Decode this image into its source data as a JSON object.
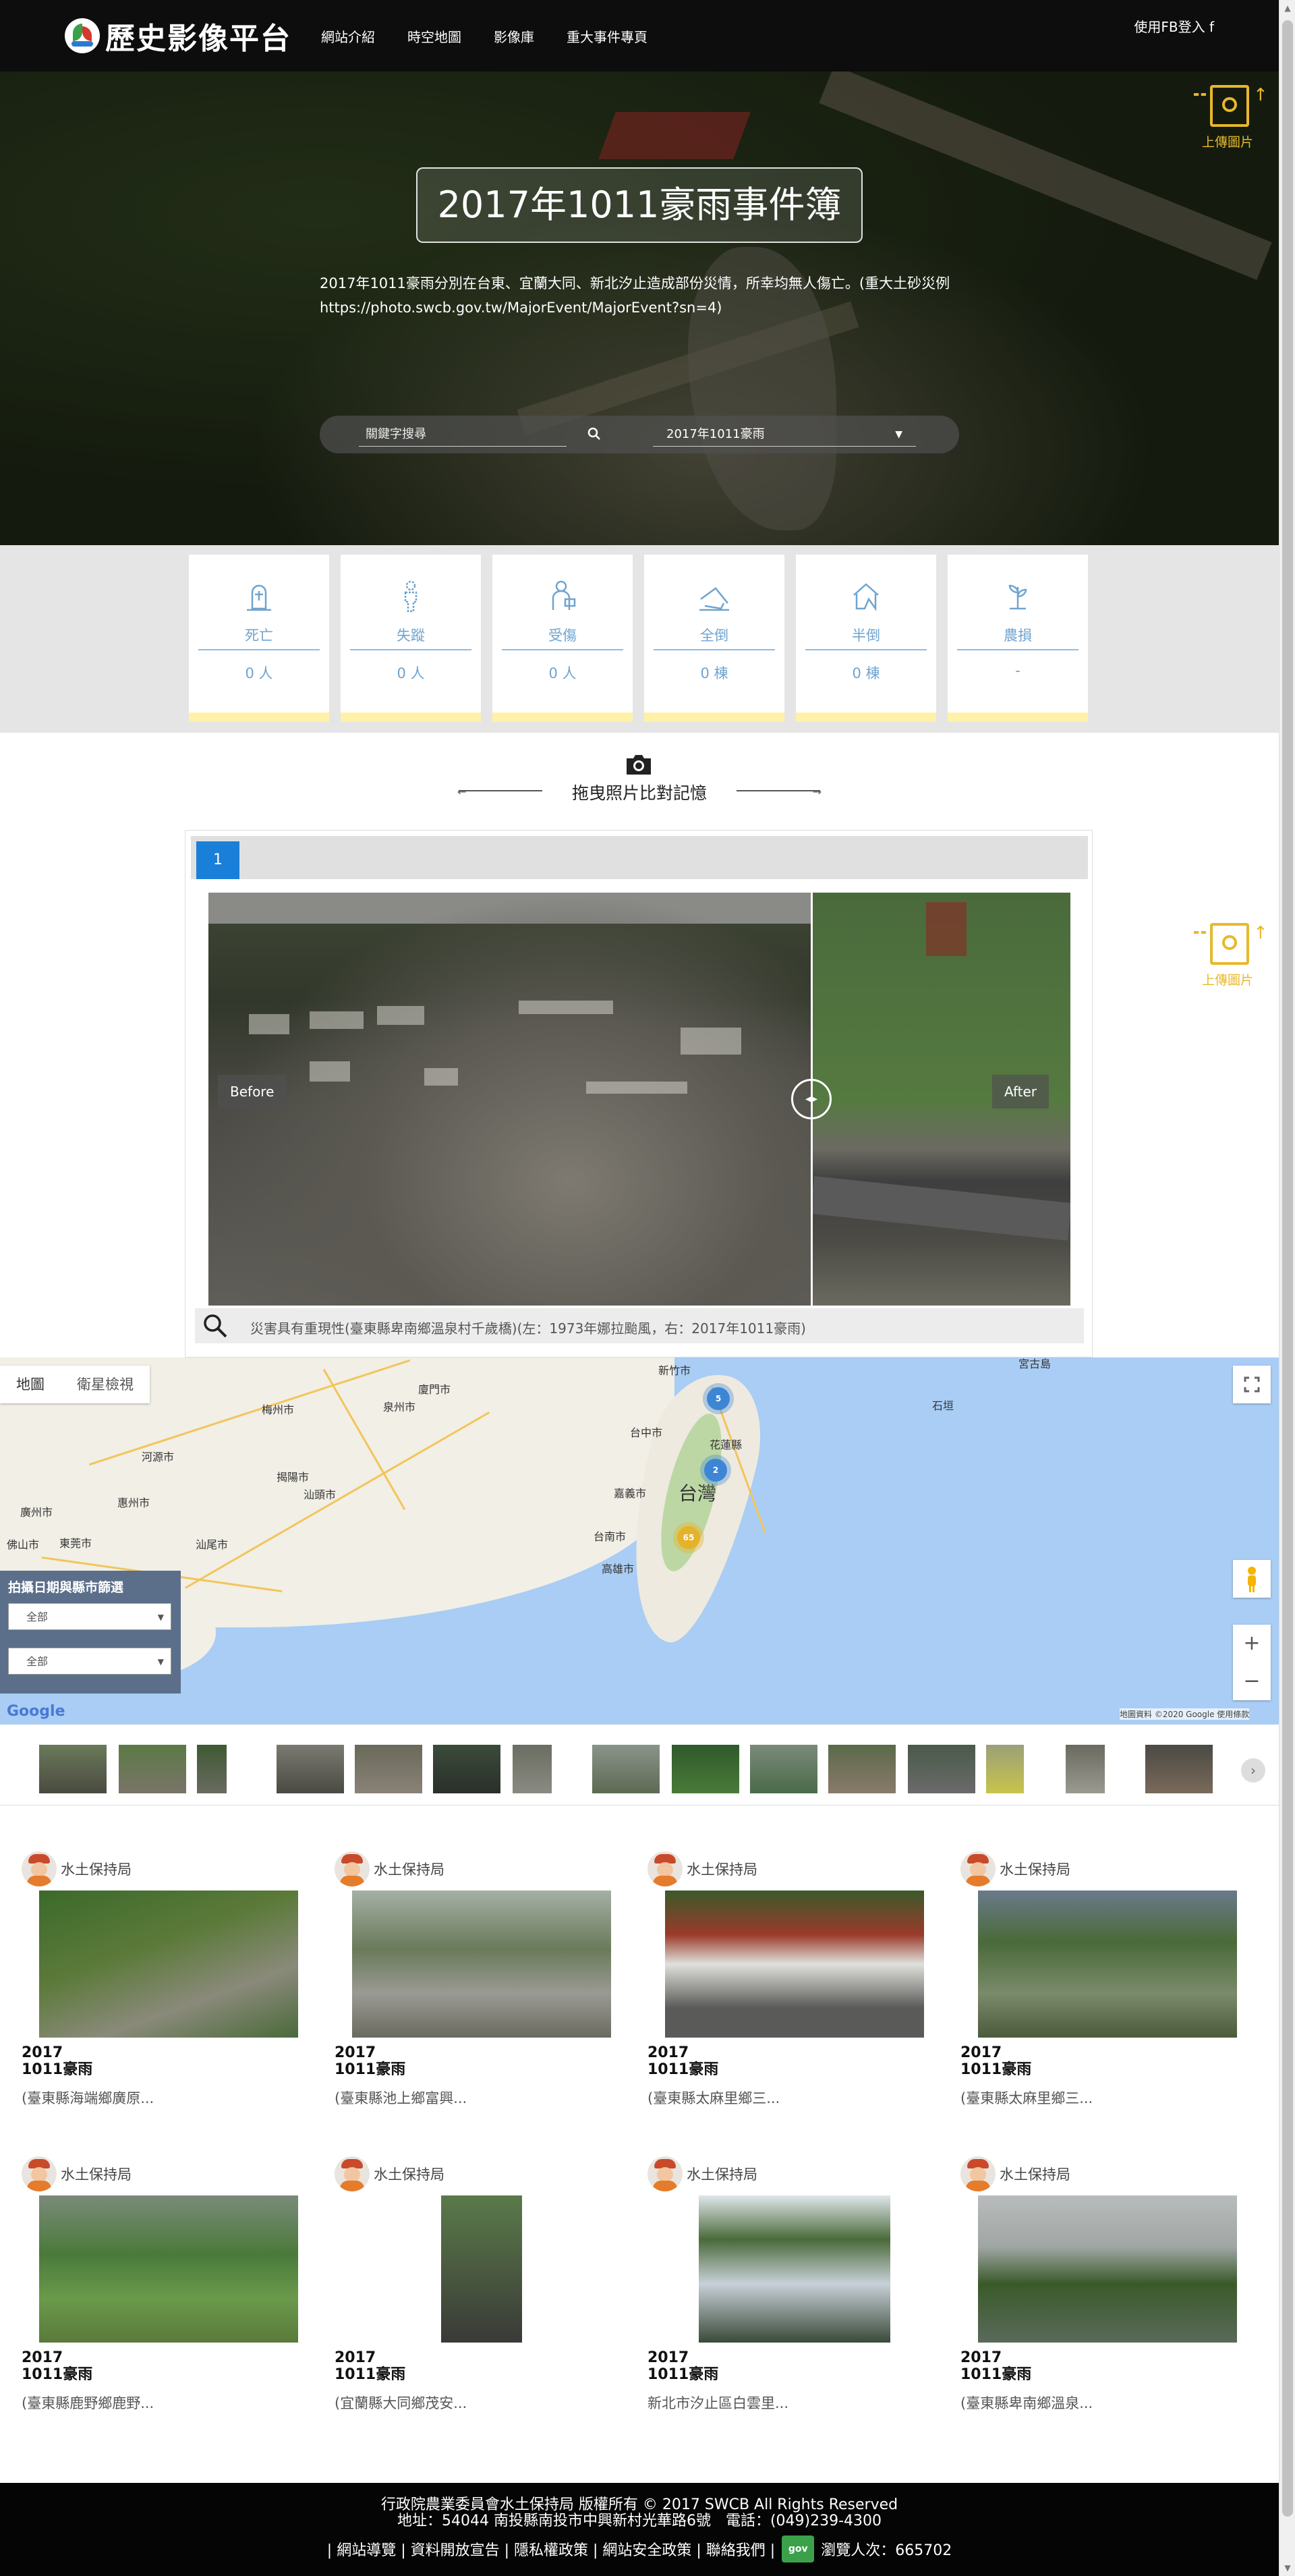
{
  "nav": {
    "logo_text": "歷史影像平台",
    "menu": [
      "網站介紹",
      "時空地圖",
      "影像庫",
      "重大事件專頁"
    ],
    "fb_login": "使用FB登入 f"
  },
  "hero": {
    "title": "2017年1011豪雨事件簿",
    "description": "2017年1011豪雨分別在台東、宜蘭大同、新北汐止造成部份災情，所幸均無人傷亡。(重大土砂災例 https://photo.swcb.gov.tw/MajorEvent/MajorEvent?sn=4)",
    "search_placeholder": "關鍵字搜尋",
    "event_select": "2017年1011豪雨",
    "upload_label": "上傳圖片"
  },
  "stats": [
    {
      "icon": "death-icon",
      "label": "死亡",
      "value": "0 人"
    },
    {
      "icon": "missing-icon",
      "label": "失蹤",
      "value": "0 人"
    },
    {
      "icon": "injured-icon",
      "label": "受傷",
      "value": "0 人"
    },
    {
      "icon": "collapsed-house-icon",
      "label": "全倒",
      "value": "0 棟"
    },
    {
      "icon": "half-collapsed-house-icon",
      "label": "半倒",
      "value": "0 棟"
    },
    {
      "icon": "agriculture-loss-icon",
      "label": "農損",
      "value": "-"
    }
  ],
  "compare": {
    "title": "拖曳照片比對記憶",
    "tab": "1",
    "before_label": "Before",
    "after_label": "After",
    "caption": "災害具有重現性(臺東縣卑南鄉溫泉村千歲橋)(左：1973年娜拉颱風，右：2017年1011豪雨)"
  },
  "map": {
    "type_map": "地圖",
    "type_satellite": "衛星檢視",
    "filter_title": "拍攝日期與縣市篩選",
    "filter_date": "全部",
    "filter_county": "全部",
    "country_label": "台灣",
    "clusters": [
      "5",
      "2",
      "65"
    ],
    "places": [
      "新竹市",
      "台中市",
      "花蓮縣",
      "嘉義市",
      "台南市",
      "高雄市",
      "廈門市",
      "泉州市",
      "梅州市",
      "河源市",
      "惠州市",
      "廣州市",
      "佛山市",
      "東莞市",
      "汕尾市",
      "揭陽市",
      "汕頭市",
      "宮古島",
      "石垣"
    ],
    "google": "Google",
    "attribution": "地圖資料 ©2020 Google   使用條款"
  },
  "cards": [
    {
      "author": "水土保持局",
      "date1": "2017",
      "date2": "1011豪雨",
      "location": "(臺東縣海端鄉廣原..."
    },
    {
      "author": "水土保持局",
      "date1": "2017",
      "date2": "1011豪雨",
      "location": "(臺東縣池上鄉富興..."
    },
    {
      "author": "水土保持局",
      "date1": "2017",
      "date2": "1011豪雨",
      "location": "(臺東縣太麻里鄉三..."
    },
    {
      "author": "水土保持局",
      "date1": "2017",
      "date2": "1011豪雨",
      "location": "(臺東縣太麻里鄉三..."
    },
    {
      "author": "水土保持局",
      "date1": "2017",
      "date2": "1011豪雨",
      "location": "(臺東縣鹿野鄉鹿野..."
    },
    {
      "author": "水土保持局",
      "date1": "2017",
      "date2": "1011豪雨",
      "location": "(宜蘭縣大同鄉茂安..."
    },
    {
      "author": "水土保持局",
      "date1": "2017",
      "date2": "1011豪雨",
      "location": "新北市汐止區白雲里..."
    },
    {
      "author": "水土保持局",
      "date1": "2017",
      "date2": "1011豪雨",
      "location": "(臺東縣卑南鄉溫泉..."
    }
  ],
  "footer": {
    "line1": "行政院農業委員會水土保持局 版權所有 © 2017 SWCB All Rights Reserved",
    "line2": "地址：54044 南投縣南投市中興新村光華路6號　電話：(049)239-4300",
    "links": "| 網站導覽 | 資料開放宣告 | 隱私權政策 | 網站安全政策 | 聯絡我們 |",
    "gov": "gov",
    "visitors": "瀏覽人次：665702"
  }
}
